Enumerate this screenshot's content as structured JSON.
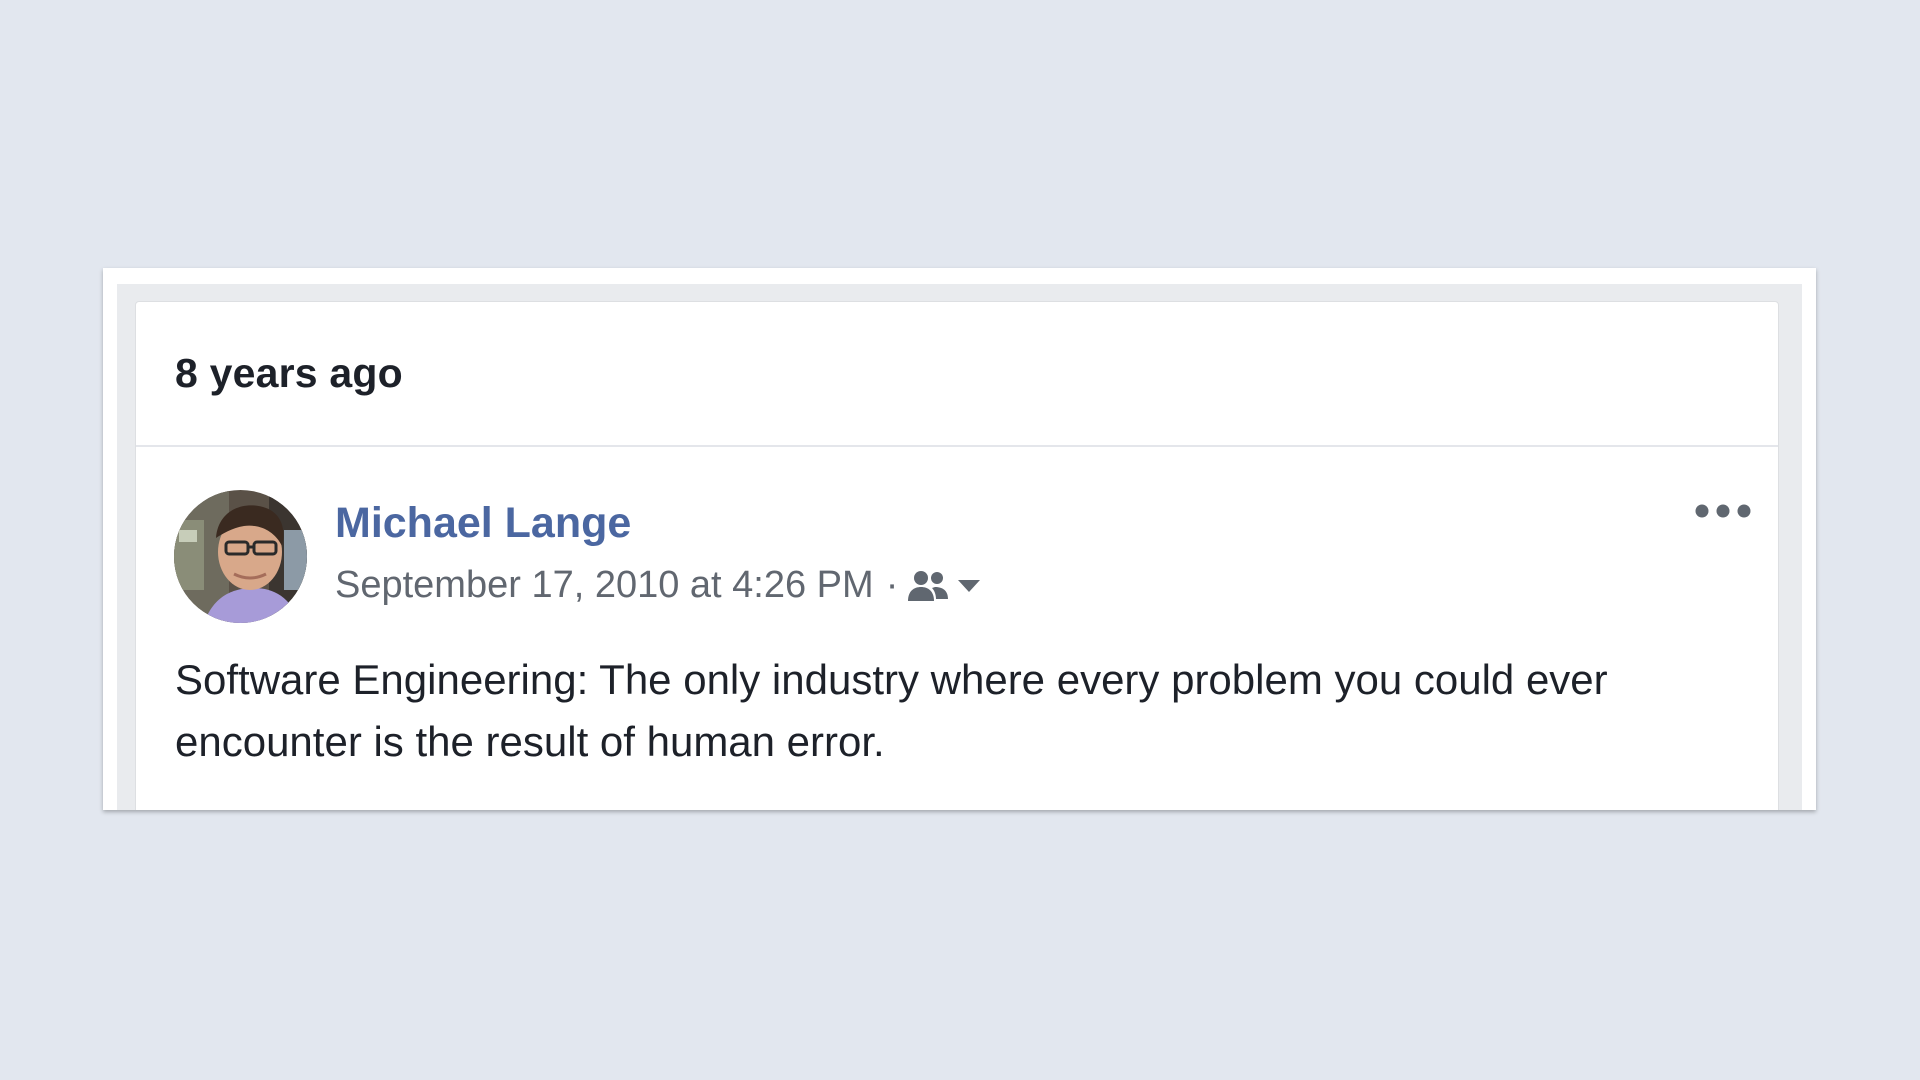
{
  "memory": {
    "header_title": "8 years ago"
  },
  "post": {
    "author_name": "Michael Lange",
    "timestamp": "September 17, 2010 at 4:26 PM",
    "separator": "·",
    "audience_icon": "friends-icon",
    "text": "Software Engineering: The only industry where every problem you could ever encounter is the result of human error."
  },
  "icons": {
    "more": "more-options-icon",
    "chevron": "chevron-down-icon"
  },
  "colors": {
    "page_background": "#e2e7ef",
    "author_link": "#4b67a1",
    "meta_text": "#616770",
    "body_text": "#1d2129"
  }
}
